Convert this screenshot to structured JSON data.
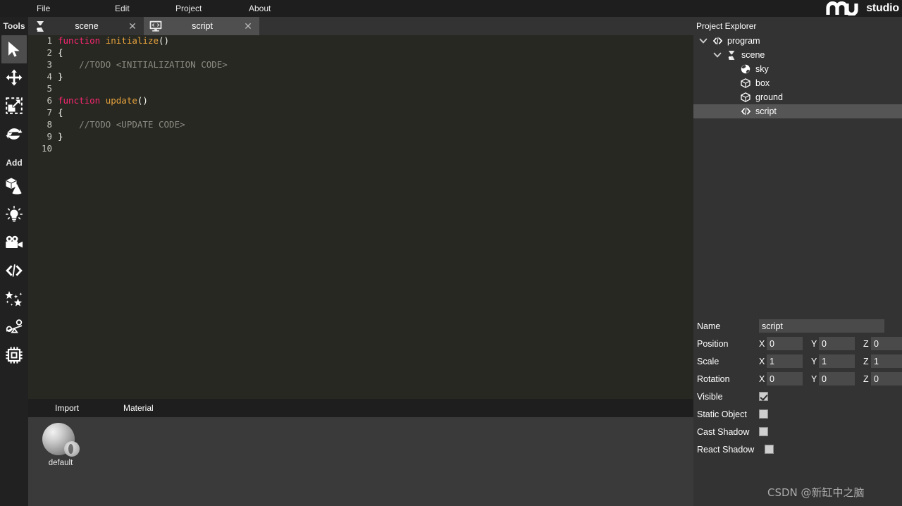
{
  "app": {
    "logo_text": "studio",
    "logo_mark": "wave-logo-icon",
    "watermark": "CSDN @新缸中之脑"
  },
  "menubar": {
    "items": [
      {
        "label": "File"
      },
      {
        "label": "Edit"
      },
      {
        "label": "Project"
      },
      {
        "label": "About"
      }
    ]
  },
  "tabs": [
    {
      "label": "scene",
      "icon": "scene-icon",
      "active": false,
      "close": "✕"
    },
    {
      "label": "script",
      "icon": "script-monitor-icon",
      "active": true,
      "close": "✕"
    }
  ],
  "toolbar": {
    "tools_label": "Tools",
    "add_label": "Add",
    "tools": [
      {
        "name": "select-tool",
        "icon": "cursor-icon",
        "active": true
      },
      {
        "name": "move-tool",
        "icon": "move-arrows-icon",
        "active": false
      },
      {
        "name": "scale-tool",
        "icon": "scale-icon",
        "active": false
      },
      {
        "name": "rotate-tool",
        "icon": "rotate-icon",
        "active": false
      }
    ],
    "add": [
      {
        "name": "add-shape",
        "icon": "cube-cone-icon"
      },
      {
        "name": "add-light",
        "icon": "light-bulb-icon"
      },
      {
        "name": "add-camera",
        "icon": "camera-icon"
      },
      {
        "name": "add-script",
        "icon": "code-brackets-icon"
      },
      {
        "name": "add-particles",
        "icon": "stars-sparkle-icon"
      },
      {
        "name": "add-physics",
        "icon": "physics-lever-icon"
      },
      {
        "name": "add-component",
        "icon": "chip-icon"
      }
    ]
  },
  "code": {
    "lines": [
      {
        "n": "1",
        "tokens": [
          {
            "t": "function ",
            "c": "k-kw"
          },
          {
            "t": "initialize",
            "c": "k-fn"
          },
          {
            "t": "()",
            "c": "k-pn"
          }
        ]
      },
      {
        "n": "2",
        "tokens": [
          {
            "t": "{",
            "c": "k-pn"
          }
        ]
      },
      {
        "n": "3",
        "tokens": [
          {
            "t": "    //TODO <INITIALIZATION CODE>",
            "c": "k-cm"
          }
        ]
      },
      {
        "n": "4",
        "tokens": [
          {
            "t": "}",
            "c": "k-pn"
          }
        ]
      },
      {
        "n": "5",
        "tokens": [
          {
            "t": "",
            "c": "k-pn"
          }
        ]
      },
      {
        "n": "6",
        "tokens": [
          {
            "t": "function ",
            "c": "k-kw"
          },
          {
            "t": "update",
            "c": "k-fn"
          },
          {
            "t": "()",
            "c": "k-pn"
          }
        ]
      },
      {
        "n": "7",
        "tokens": [
          {
            "t": "{",
            "c": "k-pn"
          }
        ]
      },
      {
        "n": "8",
        "tokens": [
          {
            "t": "    //TODO <UPDATE CODE>",
            "c": "k-cm"
          }
        ]
      },
      {
        "n": "9",
        "tokens": [
          {
            "t": "}",
            "c": "k-pn"
          }
        ]
      },
      {
        "n": "10",
        "tokens": [
          {
            "t": "",
            "c": "k-pn"
          }
        ]
      }
    ]
  },
  "asset_panel": {
    "tabs": [
      {
        "label": "Import"
      },
      {
        "label": "Material"
      }
    ],
    "items": [
      {
        "label": "default",
        "icon": "material-sphere-icon"
      }
    ]
  },
  "explorer": {
    "title": "Project Explorer",
    "nodes": [
      {
        "label": "program",
        "icon": "code-brackets-icon",
        "indent": 1,
        "twisty": "chevron-down-icon",
        "selected": false
      },
      {
        "label": "scene",
        "icon": "scene-icon",
        "indent": 2,
        "twisty": "chevron-down-icon",
        "selected": false
      },
      {
        "label": "sky",
        "icon": "sky-globe-icon",
        "indent": 3,
        "twisty": "",
        "selected": false
      },
      {
        "label": "box",
        "icon": "cube-icon",
        "indent": 3,
        "twisty": "",
        "selected": false
      },
      {
        "label": "ground",
        "icon": "cube-icon",
        "indent": 3,
        "twisty": "",
        "selected": false
      },
      {
        "label": "script",
        "icon": "code-brackets-icon",
        "indent": 3,
        "twisty": "",
        "selected": true
      }
    ]
  },
  "properties": {
    "name": {
      "label": "Name",
      "value": "script"
    },
    "position": {
      "label": "Position",
      "axes": [
        "X",
        "Y",
        "Z"
      ],
      "values": [
        "0",
        "0",
        "0"
      ]
    },
    "scale": {
      "label": "Scale",
      "axes": [
        "X",
        "Y",
        "Z"
      ],
      "values": [
        "1",
        "1",
        "1"
      ]
    },
    "rotation": {
      "label": "Rotation",
      "axes": [
        "X",
        "Y",
        "Z"
      ],
      "values": [
        "0",
        "0",
        "0"
      ]
    },
    "visible": {
      "label": "Visible",
      "checked": true
    },
    "static_object": {
      "label": "Static Object",
      "checked": false
    },
    "cast_shadow": {
      "label": "Cast Shadow",
      "checked": false
    },
    "react_shadow": {
      "label": "React Shadow",
      "checked": false
    }
  },
  "colors": {
    "chrome": "#1e1e1e",
    "panel": "#333333",
    "editor_bg": "#272822",
    "field": "#4a4a4a",
    "selected_row": "#555555",
    "keyword": "#f92672",
    "function": "#e6a23c",
    "comment": "#8d8d84"
  }
}
